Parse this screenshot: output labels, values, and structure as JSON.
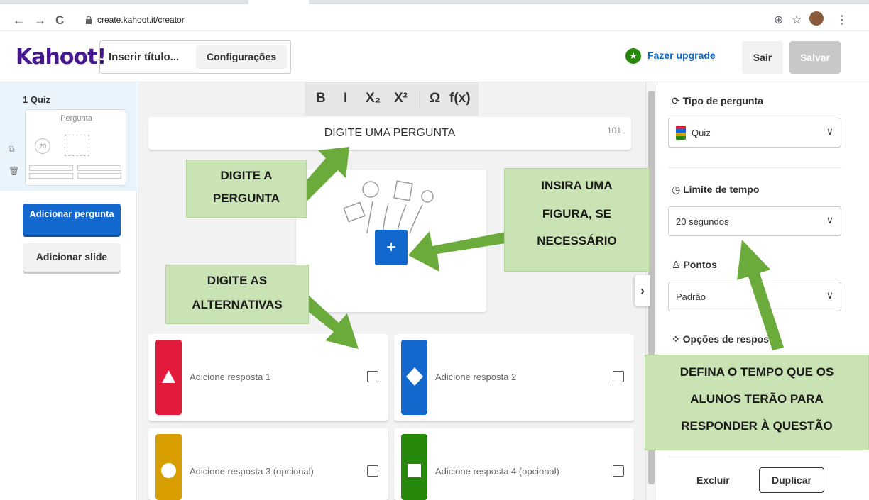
{
  "browser": {
    "url": "create.kahoot.it/creator",
    "back_icon": "←",
    "forward_icon": "→",
    "reload_icon": "C",
    "zoom_icon": "⊕",
    "star_icon": "☆",
    "menu_icon": "⋮"
  },
  "header": {
    "logo": "Kahoot!",
    "title_placeholder": "Inserir título...",
    "settings_label": "Configurações",
    "upgrade_label": "Fazer upgrade",
    "exit_label": "Sair",
    "save_label": "Salvar"
  },
  "sidebar": {
    "slide_label": "1 Quiz",
    "thumb_question": "Pergunta",
    "thumb_timer": "20",
    "add_question_label": "Adicionar pergunta",
    "add_slide_label": "Adicionar slide"
  },
  "editor": {
    "format_buttons": [
      "B",
      "I",
      "X₂",
      "X²",
      "Ω",
      "f(x)"
    ],
    "question_placeholder": "DIGITE UMA PERGUNTA",
    "char_count": "101",
    "answers": [
      {
        "placeholder": "Adicione resposta 1",
        "color": "#e21b3c",
        "shape": "triangle"
      },
      {
        "placeholder": "Adicione resposta 2",
        "color": "#1368ce",
        "shape": "diamond"
      },
      {
        "placeholder": "Adicione resposta 3 (opcional)",
        "color": "#d89e00",
        "shape": "circle"
      },
      {
        "placeholder": "Adicione resposta 4 (opcional)",
        "color": "#26890c",
        "shape": "square"
      }
    ]
  },
  "settings": {
    "question_type_label": "Tipo de pergunta",
    "question_type_value": "Quiz",
    "time_limit_label": "Limite de tempo",
    "time_limit_value": "20 segundos",
    "points_label": "Pontos",
    "points_value": "Padrão",
    "answer_options_label": "Opções de respos",
    "delete_label": "Excluir",
    "duplicate_label": "Duplicar"
  },
  "annotations": {
    "question_line1": "DIGITE A",
    "question_line2": "PERGUNTA",
    "image_line1": "INSIRA UMA",
    "image_line2": "FIGURA, SE",
    "image_line3": "NECESSÁRIO",
    "answers_line1": "DIGITE AS",
    "answers_line2": "ALTERNATIVAS",
    "time_line1": "DEFINA O TEMPO QUE OS",
    "time_line2": "ALUNOS TERÃO PARA",
    "time_line3": "RESPONDER À QUESTÃO",
    "color": "#c9e3b4",
    "arrow_color": "#6aab3c"
  }
}
